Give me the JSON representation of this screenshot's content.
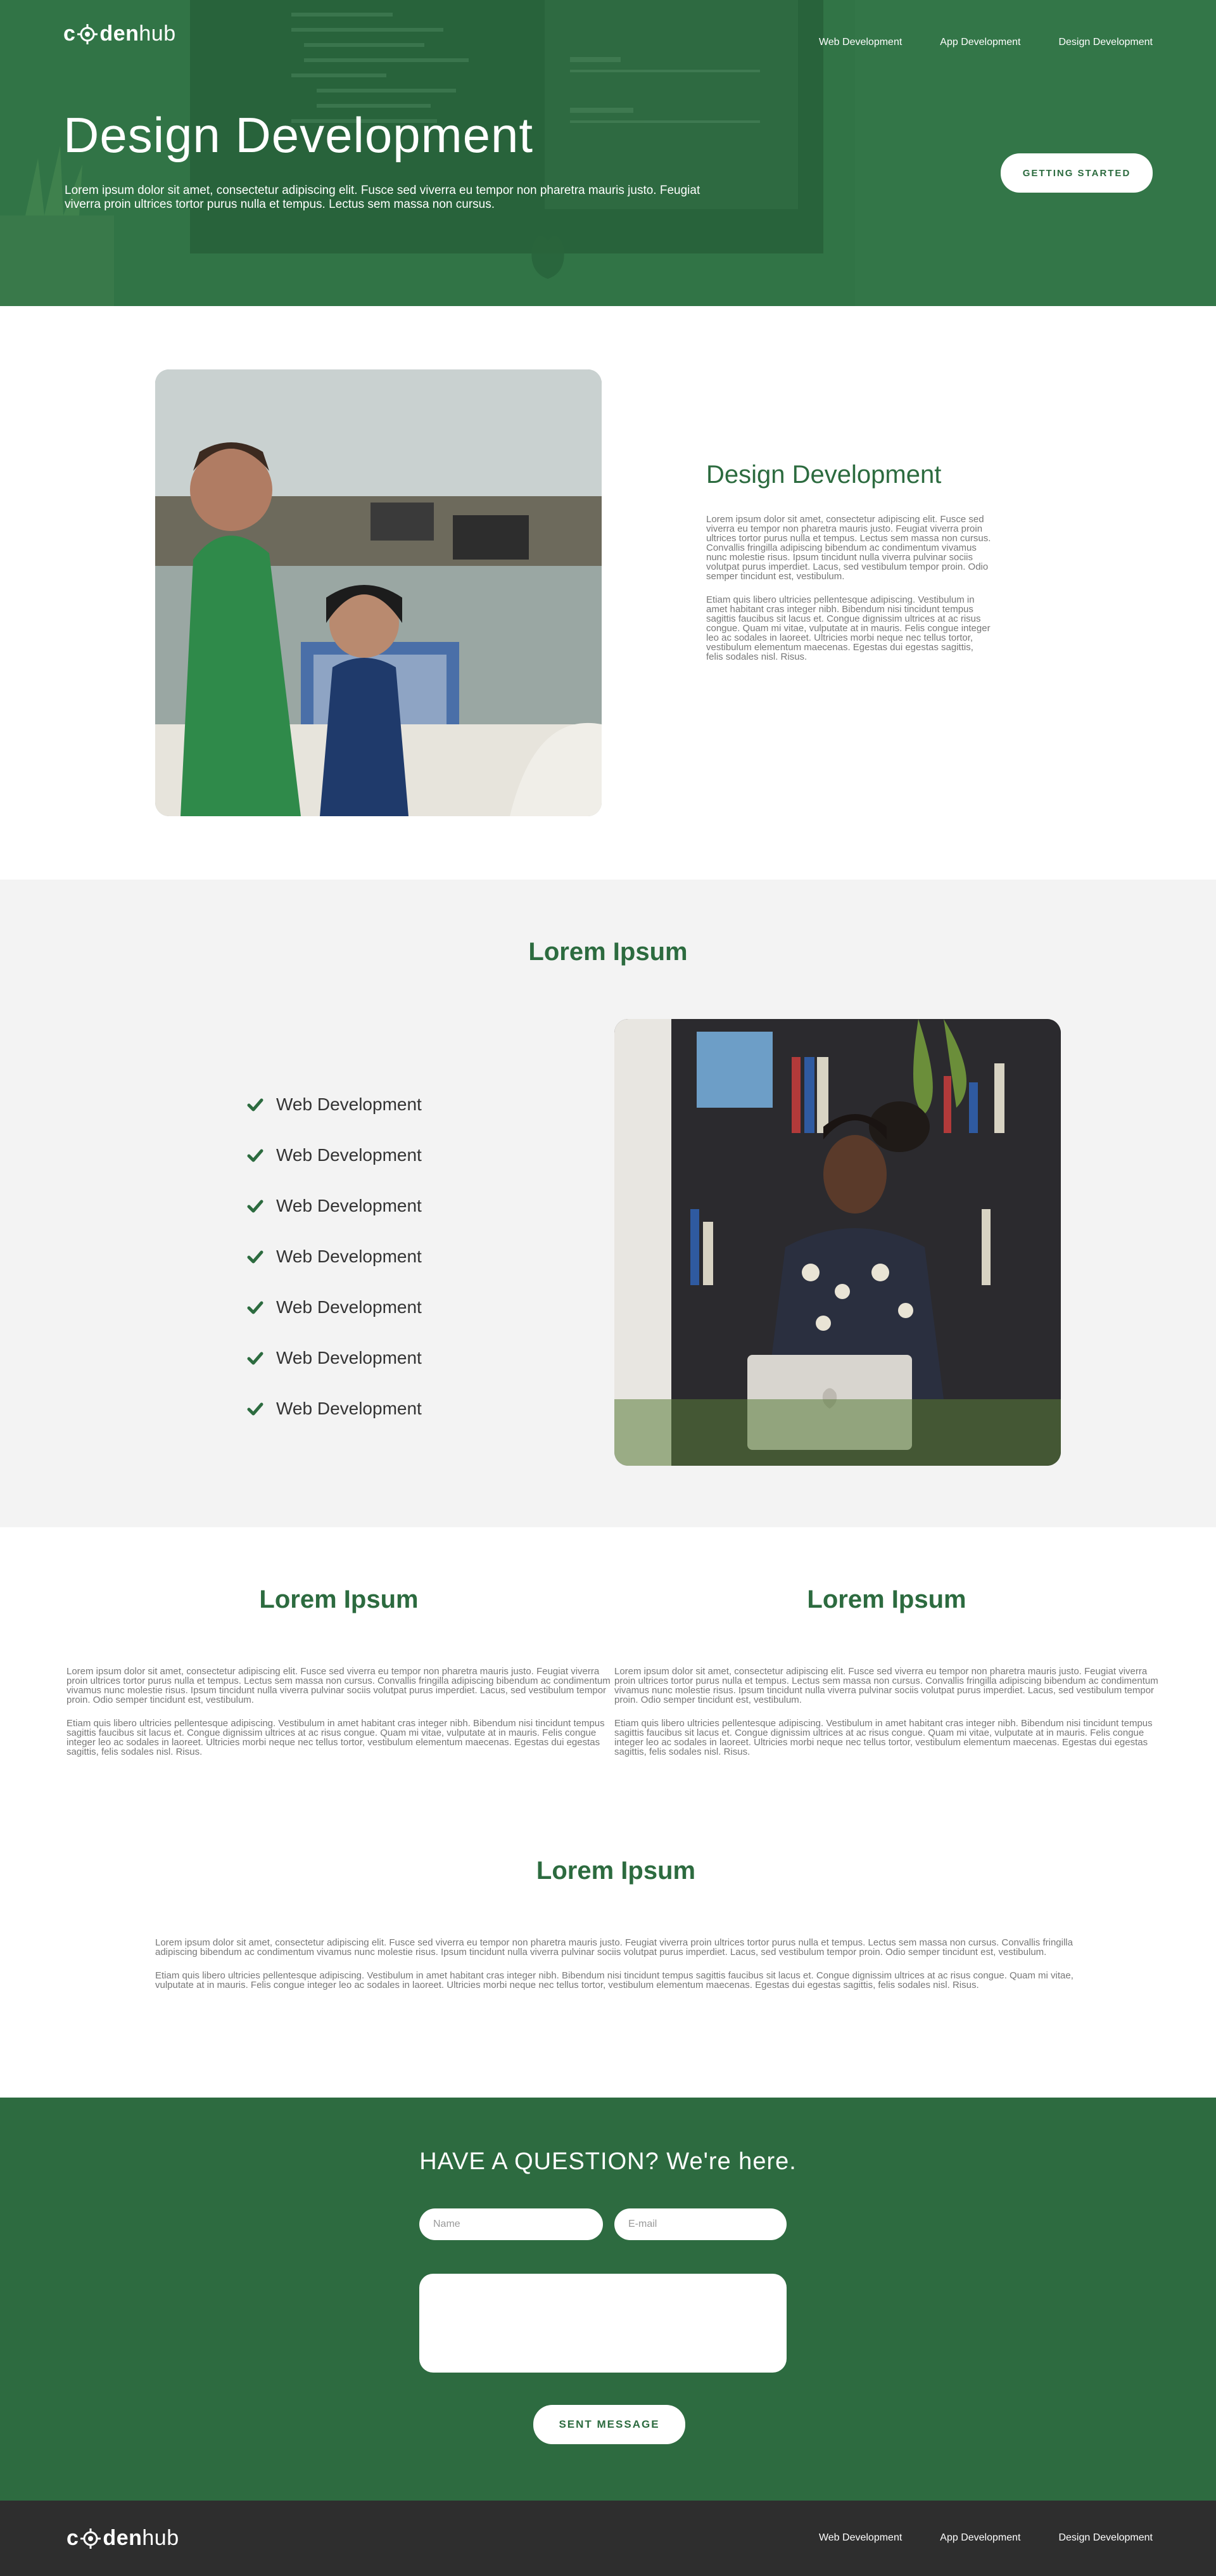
{
  "brand": {
    "logo_c": "c",
    "logo_den": "den",
    "logo_hub": "hub"
  },
  "nav": {
    "items": [
      "Web Development",
      "App Development",
      "Design Development"
    ]
  },
  "hero": {
    "title": "Design Development",
    "subtitle": "Lorem ipsum dolor sit amet, consectetur adipiscing elit. Fusce sed viverra eu tempor non pharetra mauris justo. Feugiat viverra proin ultrices tortor purus nulla et tempus. Lectus sem massa non cursus.",
    "cta": "GETTING STARTED"
  },
  "section1": {
    "title": "Design Development",
    "paragraphs": [
      "Lorem ipsum dolor sit amet, consectetur adipiscing elit. Fusce sed viverra eu tempor non pharetra mauris justo. Feugiat viverra proin ultrices tortor purus nulla et tempus. Lectus sem massa non cursus. Convallis fringilla adipiscing bibendum ac condimentum vivamus nunc molestie risus. Ipsum tincidunt nulla viverra pulvinar sociis volutpat purus imperdiet. Lacus, sed vestibulum tempor proin. Odio semper tincidunt est, vestibulum.",
      "Etiam quis libero ultricies pellentesque adipiscing. Vestibulum in amet habitant cras integer nibh. Bibendum nisi tincidunt tempus sagittis faucibus sit lacus et. Congue dignissim ultrices at ac risus congue. Quam mi vitae, vulputate at in mauris. Felis congue integer leo ac sodales in laoreet. Ultricies morbi neque nec tellus tortor, vestibulum elementum maecenas. Egestas dui egestas sagittis, felis sodales nisl. Risus."
    ]
  },
  "section2": {
    "title": "Lorem Ipsum",
    "checklist": [
      "Web Development",
      "Web Development",
      "Web Development",
      "Web Development",
      "Web Development",
      "Web Development",
      "Web Development"
    ]
  },
  "section3": {
    "columns": [
      {
        "title": "Lorem Ipsum",
        "paragraphs": [
          "Lorem ipsum dolor sit amet, consectetur adipiscing elit. Fusce sed viverra eu tempor non pharetra mauris justo. Feugiat viverra proin ultrices tortor purus nulla et tempus. Lectus sem massa non cursus. Convallis fringilla adipiscing bibendum ac condimentum vivamus nunc molestie risus. Ipsum tincidunt nulla viverra pulvinar sociis volutpat purus imperdiet. Lacus, sed vestibulum tempor proin. Odio semper tincidunt est, vestibulum.",
          "Etiam quis libero ultricies pellentesque adipiscing. Vestibulum in amet habitant cras integer nibh. Bibendum nisi tincidunt tempus sagittis faucibus sit lacus et. Congue dignissim ultrices at ac risus congue. Quam mi vitae, vulputate at in mauris. Felis congue integer leo ac sodales in laoreet. Ultricies morbi neque nec tellus tortor, vestibulum elementum maecenas. Egestas dui egestas sagittis, felis sodales nisl. Risus."
        ]
      },
      {
        "title": "Lorem Ipsum",
        "paragraphs": [
          "Lorem ipsum dolor sit amet, consectetur adipiscing elit. Fusce sed viverra eu tempor non pharetra mauris justo. Feugiat viverra proin ultrices tortor purus nulla et tempus. Lectus sem massa non cursus. Convallis fringilla adipiscing bibendum ac condimentum vivamus nunc molestie risus. Ipsum tincidunt nulla viverra pulvinar sociis volutpat purus imperdiet. Lacus, sed vestibulum tempor proin. Odio semper tincidunt est, vestibulum.",
          "Etiam quis libero ultricies pellentesque adipiscing. Vestibulum in amet habitant cras integer nibh. Bibendum nisi tincidunt tempus sagittis faucibus sit lacus et. Congue dignissim ultrices at ac risus congue. Quam mi vitae, vulputate at in mauris. Felis congue integer leo ac sodales in laoreet. Ultricies morbi neque nec tellus tortor, vestibulum elementum maecenas. Egestas dui egestas sagittis, felis sodales nisl. Risus."
        ]
      }
    ],
    "wide": {
      "title": "Lorem Ipsum",
      "paragraphs": [
        "Lorem ipsum dolor sit amet, consectetur adipiscing elit. Fusce sed viverra eu tempor non pharetra mauris justo. Feugiat viverra proin ultrices tortor purus nulla et tempus. Lectus sem massa non cursus. Convallis fringilla adipiscing bibendum ac condimentum vivamus nunc molestie risus. Ipsum tincidunt nulla viverra pulvinar sociis volutpat purus imperdiet. Lacus, sed vestibulum tempor proin. Odio semper tincidunt est, vestibulum.",
        "Etiam quis libero ultricies pellentesque adipiscing. Vestibulum in amet habitant cras integer nibh. Bibendum nisi tincidunt tempus sagittis faucibus sit lacus et. Congue dignissim ultrices at ac risus congue. Quam mi vitae, vulputate at in mauris. Felis congue integer leo ac sodales in laoreet. Ultricies morbi neque nec tellus tortor, vestibulum elementum maecenas. Egestas dui egestas sagittis, felis sodales nisl. Risus."
      ]
    }
  },
  "contact": {
    "title": "HAVE A QUESTION? We're here.",
    "name_placeholder": "Name",
    "email_placeholder": "E-mail",
    "submit": "SENT MESSAGE"
  },
  "colors": {
    "brand_green": "#2c6b3f",
    "text_gray": "#777777",
    "footer_dark": "#2e2e2e",
    "light_bg": "#f3f3f3"
  },
  "icons": {
    "check": "check-icon",
    "logo_gear": "gear-icon"
  }
}
